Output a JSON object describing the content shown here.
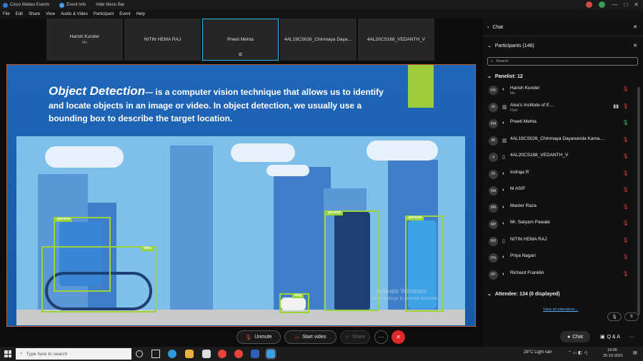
{
  "titlebar": {
    "app": "Cisco Webex Events",
    "event_info": "Event Info",
    "hide_menu": "Hide Menu Bar",
    "window_controls": [
      "—",
      "□",
      "✕"
    ]
  },
  "menu": [
    "File",
    "Edit",
    "Share",
    "View",
    "Audio & Video",
    "Participant",
    "Event",
    "Help"
  ],
  "tiles": [
    {
      "name": "Harish Kunder",
      "sub": "Me"
    },
    {
      "name": "NITIN HEMA RAJ",
      "sub": ""
    },
    {
      "name": "Preeti Mehta",
      "sub": ""
    },
    {
      "name": "4AL19CS026_Chinmaya Daya…",
      "sub": ""
    },
    {
      "name": "4AL20CS168_VEDANTH_V",
      "sub": ""
    }
  ],
  "slide": {
    "title": "Object Detection",
    "title_mark": "—",
    "text_1": " is a computer vision technique that allows us to identify",
    "text_2": "and locate objects in an image or video. In object detection, we usually use a",
    "text_3": "bounding box to describe the target location.",
    "labels": {
      "person1": "person",
      "bike": "bike",
      "dog": "dog",
      "person2": "person",
      "person3": "person"
    },
    "watermark_1": "Activate Windows",
    "watermark_2": "Go to Settings to activate Windows."
  },
  "controls": {
    "unmute": "Unmute",
    "start_video": "Start video",
    "share": "Share",
    "more": "···",
    "end": "✕"
  },
  "panel": {
    "chat_title": "Chat",
    "participants_title": "Participants (146)",
    "search_placeholder": "Search",
    "panelist_header": "Panelist: 12",
    "panelists": [
      {
        "initials": "HK",
        "name": "Harish Kunder",
        "sub": "Me"
      },
      {
        "initials": "AI",
        "name": "Alva's Institute of E…",
        "sub": "Host"
      },
      {
        "initials": "PM",
        "name": "Preeti Mehta",
        "sub": ""
      },
      {
        "initials": "4K",
        "name": "4AL19CS026_Chinmaya Dayananda Kama…",
        "sub": ""
      },
      {
        "initials": "4",
        "name": "4AL20CS168_VEDANTH_V",
        "sub": ""
      },
      {
        "initials": "IR",
        "name": "Indraja R",
        "sub": ""
      },
      {
        "initials": "MA",
        "name": "M ASIF",
        "sub": ""
      },
      {
        "initials": "MR",
        "name": "Master Raza",
        "sub": ""
      },
      {
        "initials": "MP",
        "name": "Mr. Satyam Pawale",
        "sub": ""
      },
      {
        "initials": "NR",
        "name": "NITIN HEMA RAJ",
        "sub": ""
      },
      {
        "initials": "PN",
        "name": "Priya Nagari",
        "sub": ""
      },
      {
        "initials": "RF",
        "name": "Richard Franklin",
        "sub": ""
      }
    ],
    "attendee_header": "Attendee: 134 (0 displayed)",
    "view_all": "View all attendees...",
    "chat_btn": "Chat",
    "qa_btn": "Q & A"
  },
  "taskbar": {
    "search_placeholder": "Type here to search",
    "weather": "28°C  Light rain",
    "time": "19:06",
    "date": "25-10-2021"
  },
  "colors": {
    "accent": "#35b6e8",
    "box": "#9bd43a",
    "end": "#e02828"
  }
}
